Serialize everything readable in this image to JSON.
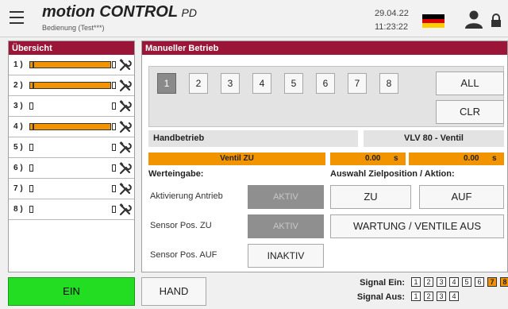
{
  "header": {
    "brand_main": "motion CONTROL",
    "brand_suffix": "PD",
    "subtitle": "Bedienung (Test***)",
    "date": "29.04.22",
    "time": "11:23:22",
    "flag_colors": [
      "#000000",
      "#dd0000",
      "#ffce00"
    ],
    "icons": [
      "menu-icon",
      "flag-de-icon",
      "user-icon",
      "lock-icon"
    ]
  },
  "overview": {
    "title": "Übersicht",
    "rows": [
      {
        "label": "1 )",
        "fill": 1.0
      },
      {
        "label": "2 )",
        "fill": 1.0
      },
      {
        "label": "3 )",
        "fill": 0.0
      },
      {
        "label": "4 )",
        "fill": 1.0
      },
      {
        "label": "5 )",
        "fill": 0.0
      },
      {
        "label": "6 )",
        "fill": 0.0
      },
      {
        "label": "7 )",
        "fill": 0.0
      },
      {
        "label": "8 )",
        "fill": 0.0
      }
    ],
    "tool_icon": "tools-icon",
    "accent_color": "#f29400"
  },
  "main": {
    "title": "Manueller Betrieb",
    "selector_buttons": [
      "1",
      "2",
      "3",
      "4",
      "5",
      "6",
      "7",
      "8"
    ],
    "selected": "1",
    "all_label": "ALL",
    "clr_label": "CLR",
    "mode_label": "Handbetrieb",
    "valve_label": "VLV 80 - Ventil",
    "status_label": "Ventil ZU",
    "value1": "0.00",
    "unit1": "s",
    "value2": "0.00",
    "unit2": "s",
    "werteingabe_title": "Werteingabe:",
    "fields": [
      {
        "label": "Aktivierung Antrieb",
        "button": "AKTIV"
      },
      {
        "label": "Sensor Pos. ZU",
        "button": "AKTIV"
      },
      {
        "label": "Sensor Pos. AUF",
        "button": "INAKTIV"
      }
    ],
    "auswahl_title": "Auswahl Zielposition / Aktion:",
    "zu_label": "ZU",
    "auf_label": "AUF",
    "wartung_label": "WARTUNG / VENTILE AUS"
  },
  "footer": {
    "ein_label": "EIN",
    "hand_label": "HAND",
    "signal_ein_label": "Signal Ein:",
    "signal_aus_label": "Signal Aus:",
    "signal_ein": [
      {
        "n": "1",
        "on": false
      },
      {
        "n": "2",
        "on": false
      },
      {
        "n": "3",
        "on": false
      },
      {
        "n": "4",
        "on": false
      },
      {
        "n": "5",
        "on": false
      },
      {
        "n": "6",
        "on": false
      },
      {
        "n": "7",
        "on": true
      },
      {
        "n": "8",
        "on": true
      }
    ],
    "signal_aus": [
      {
        "n": "1",
        "on": false
      },
      {
        "n": "2",
        "on": false
      },
      {
        "n": "3",
        "on": false
      },
      {
        "n": "4",
        "on": false
      }
    ],
    "ein_color": "#22dd22"
  }
}
